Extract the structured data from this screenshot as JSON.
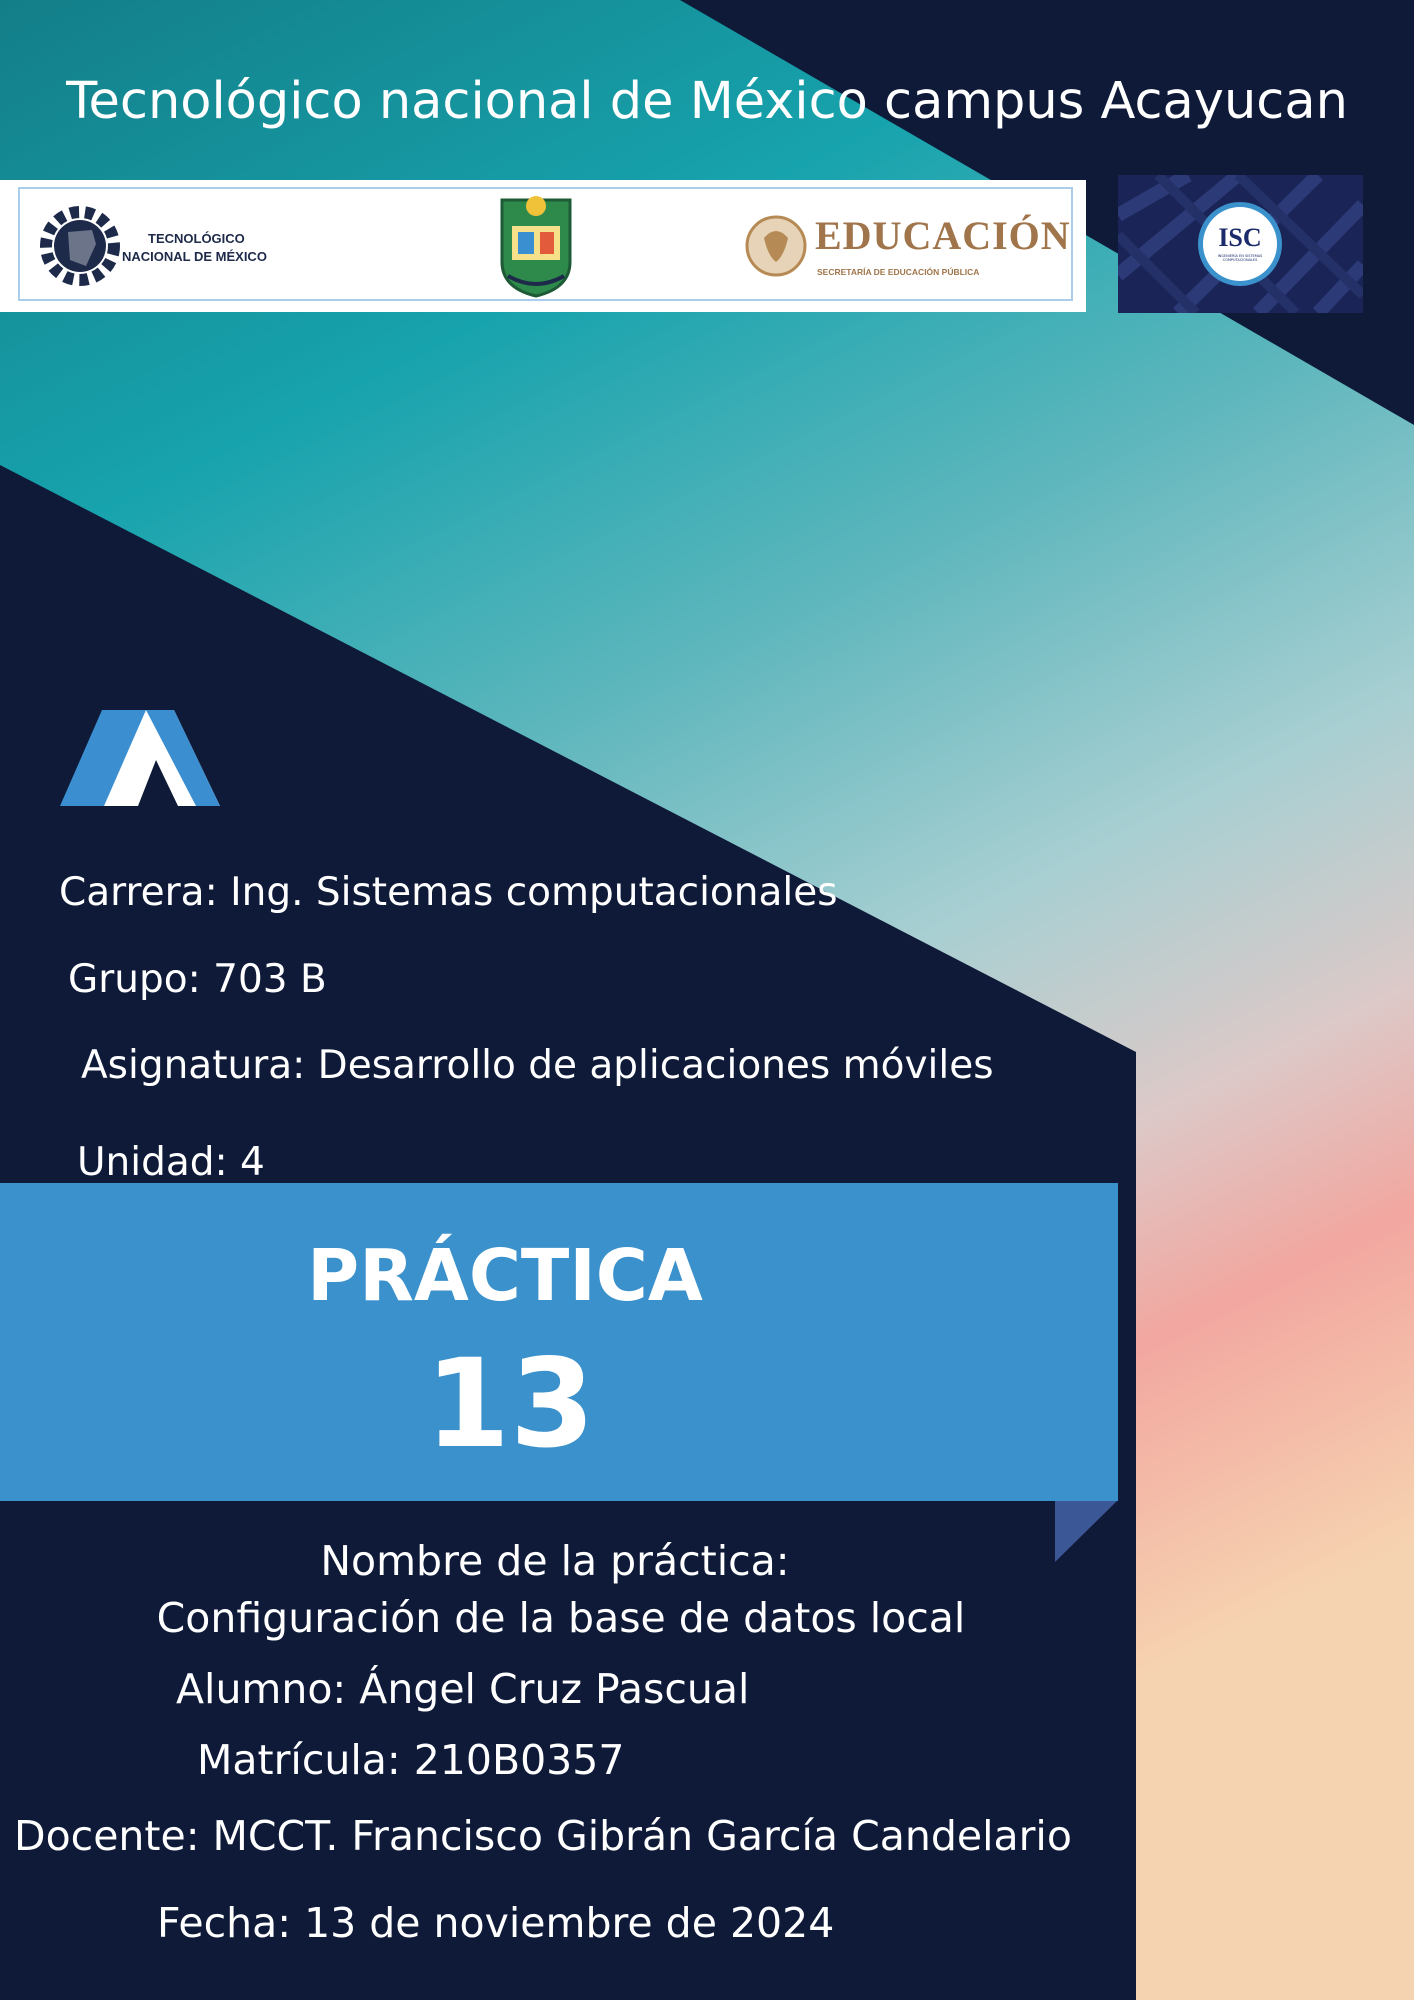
{
  "header": {
    "title": "Tecnológico nacional de México campus Acayucan"
  },
  "logos": {
    "tecnm_line1": "TECNOLÓGICO",
    "tecnm_line2": "NACIONAL DE MÉXICO",
    "educacion_title": "EDUCACIÓN",
    "educacion_subtitle": "SECRETARÍA DE EDUCACIÓN PÚBLICA",
    "isc_badge": "ISC",
    "isc_caption": "INGENIERÍA EN SISTEMAS COMPUTACIONALES"
  },
  "info": {
    "carrera": "Carrera: Ing. Sistemas computacionales",
    "grupo": "Grupo: 703 B",
    "asignatura": "Asignatura: Desarrollo de aplicaciones móviles",
    "unidad": "Unidad: 4"
  },
  "banner": {
    "label": "PRÁCTICA",
    "number": "13"
  },
  "details": {
    "nombre_label": "Nombre de la práctica:",
    "nombre_value": "Configuración de la base de datos local",
    "alumno": "Alumno: Ángel Cruz Pascual",
    "matricula": "Matrícula: 210B0357",
    "docente": "Docente: MCCT. Francisco Gibrán García Candelario",
    "fecha": "Fecha: 13 de noviembre de 2024"
  },
  "colors": {
    "navy": "#0e1a38",
    "banner_blue": "#3a91cb",
    "teal": "#1f9aa3",
    "accent_blue": "#3b8fd0"
  }
}
